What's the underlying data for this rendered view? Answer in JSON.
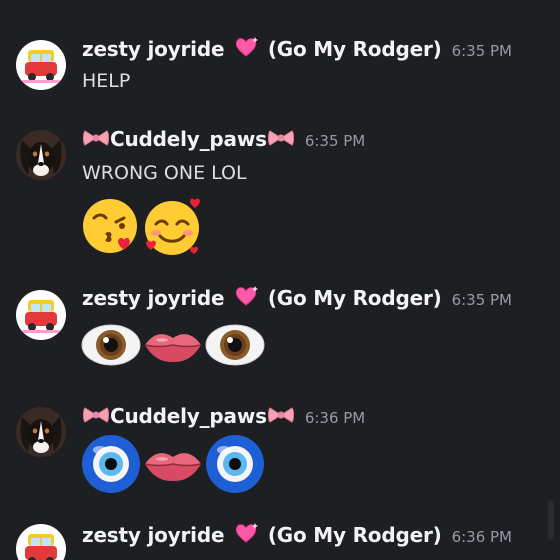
{
  "messages": [
    {
      "author": "zesty joyride",
      "author_suffix": "(Go My Rodger)",
      "time": "6:35 PM",
      "text": "HELP",
      "avatar": "toy-car-avatar"
    },
    {
      "author": "Cuddely_paws",
      "time": "6:35 PM",
      "text": "WRONG ONE LOL",
      "emojis": [
        "kissing-face-with-heart",
        "smiling-face-with-hearts"
      ],
      "avatar": "dog-avatar"
    },
    {
      "author": "zesty joyride",
      "author_suffix": "(Go My Rodger)",
      "time": "6:35 PM",
      "emojis": [
        "eye",
        "lips",
        "eye"
      ],
      "avatar": "toy-car-avatar"
    },
    {
      "author": "Cuddely_paws",
      "time": "6:36 PM",
      "emojis": [
        "nazar-amulet",
        "lips",
        "nazar-amulet"
      ],
      "avatar": "dog-avatar"
    },
    {
      "author": "zesty joyride",
      "author_suffix": "(Go My Rodger)",
      "time": "6:36 PM",
      "avatar": "toy-car-avatar"
    }
  ],
  "colors": {
    "background": "#1e1f23",
    "username": "#f2f3f5",
    "timestamp": "#949ba4",
    "text": "#dbdee1",
    "heart": "#ff4fa3",
    "bow": "#f4a3b5"
  }
}
